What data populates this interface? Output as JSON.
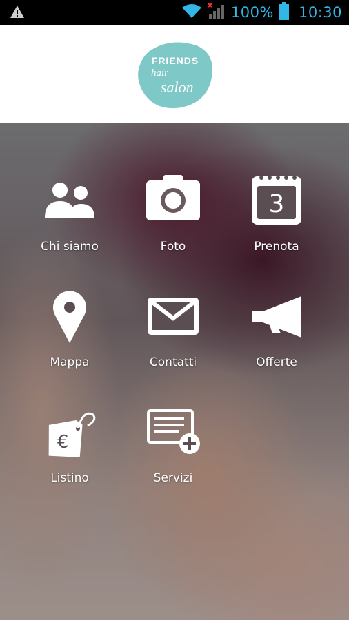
{
  "status_bar": {
    "battery_percent": "100%",
    "time": "10:30",
    "icons": [
      "warning-icon",
      "wifi-icon",
      "signal-icon",
      "battery-icon"
    ],
    "accent_color": "#33b5e5"
  },
  "header": {
    "logo_line1": "FRIENDS",
    "logo_line2": "hair",
    "logo_line3": "salon",
    "logo_color": "#7fc8c8"
  },
  "menu": {
    "items": [
      {
        "label": "Chi siamo",
        "icon": "people-icon"
      },
      {
        "label": "Foto",
        "icon": "camera-icon"
      },
      {
        "label": "Prenota",
        "icon": "calendar-icon",
        "calendar_day": "3"
      },
      {
        "label": "Mappa",
        "icon": "map-pin-icon"
      },
      {
        "label": "Contatti",
        "icon": "envelope-icon"
      },
      {
        "label": "Offerte",
        "icon": "megaphone-icon"
      },
      {
        "label": "Listino",
        "icon": "price-tag-icon",
        "currency_symbol": "€"
      },
      {
        "label": "Servizi",
        "icon": "add-list-icon"
      }
    ]
  }
}
